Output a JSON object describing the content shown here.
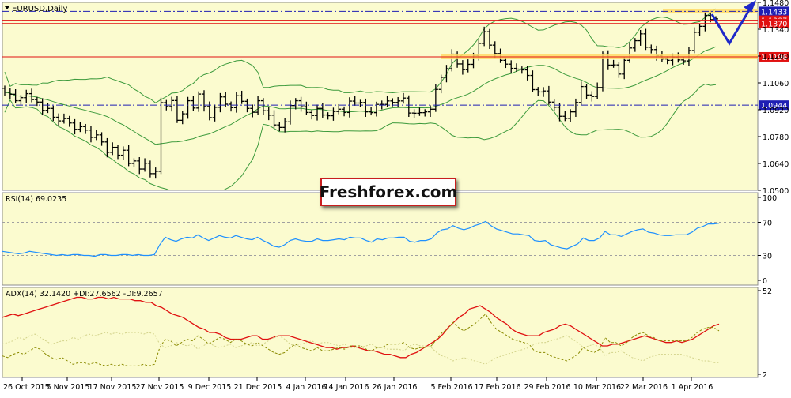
{
  "colors": {
    "background": "#fbfbcf",
    "frame": "#8c8c8c",
    "bars": "#000000",
    "bollinger": "#3c9a3c",
    "level_line": "#e11111",
    "level_band": "#ffd966",
    "dash_line": "#1e1eb4",
    "rsi_line": "#1e90ff",
    "adx_line": "#e01010",
    "plus_di": "#8a8a00",
    "minus_di": "#d2d28a",
    "forecast": "#1e28c8",
    "red_tag": "#e11111",
    "blue_tag": "#1e1eb4"
  },
  "chart_data": [
    {
      "type": "ohlc",
      "title": "EURUSD,Daily",
      "ylim": [
        1.05,
        1.148
      ],
      "y_ticks": [
        "1.1480",
        "1.1340",
        "1.1200",
        "1.1060",
        "1.0920",
        "1.0780",
        "1.0640",
        "1.0500"
      ],
      "y_tick_values": [
        1.148,
        1.134,
        1.12,
        1.106,
        1.092,
        1.078,
        1.064,
        1.05
      ],
      "x_ticks": [
        "26 Oct 2015",
        "5 Nov 2015",
        "17 Nov 2015",
        "27 Nov 2015",
        "9 Dec 2015",
        "21 Dec 2015",
        "4 Jan 2016",
        "14 Jan 2016",
        "26 Jan 2016",
        "5 Feb 2016",
        "17 Feb 2016",
        "29 Feb 2016",
        "10 Mar 2016",
        "22 Mar 2016",
        "1 Apr 2016"
      ],
      "close": [
        1.1012,
        1.1001,
        1.0967,
        1.0983,
        1.1004,
        1.0973,
        1.096,
        1.0917,
        1.0927,
        1.0881,
        1.0862,
        1.0874,
        1.0851,
        1.0818,
        1.0832,
        1.0814,
        1.0776,
        1.0789,
        1.0752,
        1.0698,
        1.0724,
        1.0683,
        1.0709,
        1.064,
        1.0653,
        1.0611,
        1.0641,
        1.0587,
        1.0599,
        1.0957,
        1.0937,
        1.0968,
        1.0865,
        1.0899,
        1.0967,
        1.0929,
        1.1002,
        1.0937,
        1.0879,
        1.0933,
        1.0987,
        1.0949,
        1.0931,
        1.0993,
        1.0964,
        1.0927,
        1.0907,
        1.0967,
        1.0915,
        1.0892,
        1.0841,
        1.0828,
        1.0857,
        1.0942,
        1.0967,
        1.0936,
        1.0906,
        1.089,
        1.0927,
        1.0893,
        1.0889,
        1.0911,
        1.0923,
        1.0906,
        1.0965,
        1.0955,
        1.0958,
        1.0909,
        1.0905,
        1.0948,
        1.0948,
        1.0966,
        1.0958,
        1.0966,
        1.0981,
        1.0903,
        1.0902,
        1.0905,
        1.0909,
        1.0923,
        1.1026,
        1.1089,
        1.1134,
        1.121,
        1.1159,
        1.1129,
        1.1157,
        1.1203,
        1.1266,
        1.1327,
        1.1257,
        1.1213,
        1.1178,
        1.1158,
        1.1136,
        1.1132,
        1.1128,
        1.1099,
        1.1025,
        1.1013,
        1.1018,
        1.096,
        1.0933,
        1.0886,
        1.0875,
        1.0909,
        1.0958,
        1.1041,
        1.0997,
        1.0989,
        1.1036,
        1.121,
        1.1153,
        1.1154,
        1.1106,
        1.1178,
        1.1242,
        1.128,
        1.1316,
        1.1246,
        1.1234,
        1.1202,
        1.1185,
        1.1178,
        1.1193,
        1.118,
        1.1175,
        1.1229,
        1.1324,
        1.1355,
        1.1412,
        1.139,
        1.1394
      ],
      "levels": [
        {
          "label": "1.1433",
          "value": 1.1433,
          "style": "dash-dot",
          "tag": "blue"
        },
        {
          "label": "1.1387",
          "value": 1.1387,
          "style": "solid",
          "tag": "red"
        },
        {
          "label": "1.1370",
          "value": 1.137,
          "style": "solid",
          "tag": "red"
        },
        {
          "label": "1.1196",
          "value": 1.1196,
          "style": "solid",
          "tag": "red"
        },
        {
          "label": "1.0944",
          "value": 1.0944,
          "style": "dash-dot",
          "tag": "blue"
        }
      ]
    },
    {
      "type": "line",
      "title": "RSI(14) 69.0235",
      "ylim": [
        0,
        100
      ],
      "y_ticks": [
        "100",
        "70",
        "30",
        "0"
      ],
      "y_tick_values": [
        100,
        70,
        30,
        0
      ],
      "reference_lines": [
        70,
        30
      ],
      "values": [
        35,
        34,
        33,
        32,
        33,
        35,
        34,
        33,
        32,
        31,
        30,
        31,
        30,
        31,
        31,
        30,
        30,
        29,
        31,
        31,
        30,
        30,
        31,
        31,
        30,
        31,
        30,
        30,
        31,
        43,
        52,
        49,
        47,
        50,
        52,
        51,
        55,
        51,
        48,
        51,
        54,
        52,
        51,
        54,
        52,
        50,
        49,
        52,
        48,
        45,
        41,
        40,
        43,
        48,
        50,
        48,
        47,
        47,
        50,
        48,
        48,
        49,
        50,
        49,
        52,
        51,
        51,
        48,
        46,
        50,
        49,
        51,
        51,
        52,
        52,
        47,
        46,
        48,
        48,
        50,
        57,
        61,
        62,
        66,
        63,
        61,
        63,
        66,
        68,
        71,
        66,
        62,
        60,
        58,
        56,
        56,
        55,
        54,
        48,
        47,
        48,
        43,
        41,
        39,
        38,
        41,
        44,
        51,
        48,
        48,
        51,
        59,
        55,
        55,
        53,
        56,
        59,
        61,
        62,
        58,
        57,
        55,
        54,
        54,
        55,
        55,
        55,
        58,
        63,
        65,
        68,
        68,
        69
      ]
    },
    {
      "type": "line",
      "title": "ADX(14) 32.1420 +DI:27.6562 -DI:9.2657",
      "ylim": [
        2,
        52
      ],
      "y_ticks": [
        "52",
        "2"
      ],
      "y_tick_values": [
        52,
        2
      ],
      "series": [
        {
          "name": "ADX(14)",
          "values": [
            36,
            37,
            38,
            37,
            38,
            39,
            40,
            41,
            42,
            43,
            44,
            45,
            46,
            47,
            48,
            48,
            47,
            47,
            48,
            48,
            47,
            48,
            47,
            47,
            47,
            46,
            46,
            45,
            45,
            43,
            42,
            40,
            38,
            37,
            36,
            34,
            32,
            30,
            29,
            27,
            27,
            26,
            24,
            23,
            23,
            23,
            24,
            25,
            25,
            23,
            23,
            24,
            25,
            25,
            25,
            24,
            23,
            22,
            21,
            20,
            19,
            18,
            18,
            17,
            18,
            18,
            19,
            18,
            17,
            16,
            16,
            15,
            14,
            14,
            13,
            12,
            12,
            14,
            15,
            17,
            19,
            21,
            23,
            26,
            30,
            33,
            36,
            38,
            41,
            42,
            43,
            41,
            39,
            36,
            34,
            32,
            29,
            27,
            26,
            25,
            25,
            25,
            27,
            28,
            29,
            31,
            32,
            31,
            29,
            27,
            25,
            23,
            21,
            19,
            19,
            20,
            20,
            21,
            22,
            23,
            24,
            25,
            24,
            23,
            22,
            21,
            21,
            22,
            21,
            22,
            23,
            25,
            27,
            29,
            31,
            32
          ]
        },
        {
          "name": "+DI",
          "values": [
            13,
            12,
            14,
            15,
            14,
            16,
            18,
            17,
            14,
            12,
            11,
            12,
            10,
            8,
            9,
            9,
            8,
            9,
            8,
            7,
            8,
            7,
            8,
            7,
            7,
            7,
            8,
            7,
            8,
            18,
            23,
            22,
            19,
            21,
            23,
            22,
            25,
            23,
            20,
            22,
            24,
            23,
            21,
            23,
            22,
            20,
            19,
            21,
            19,
            17,
            15,
            14,
            15,
            18,
            20,
            18,
            17,
            16,
            18,
            16,
            16,
            17,
            18,
            17,
            19,
            19,
            19,
            17,
            16,
            18,
            18,
            20,
            20,
            20,
            21,
            18,
            17,
            18,
            18,
            19,
            23,
            27,
            29,
            33,
            30,
            28,
            30,
            32,
            35,
            38,
            33,
            29,
            27,
            25,
            23,
            22,
            21,
            20,
            16,
            15,
            15,
            13,
            12,
            11,
            10,
            12,
            14,
            18,
            16,
            15,
            17,
            24,
            21,
            21,
            19,
            21,
            24,
            26,
            27,
            25,
            24,
            22,
            22,
            22,
            22,
            22,
            22,
            24,
            27,
            29,
            30,
            30,
            28
          ]
        },
        {
          "name": "-DI",
          "values": [
            20,
            21,
            22,
            24,
            23,
            25,
            26,
            24,
            22,
            20,
            21,
            22,
            22,
            24,
            23,
            25,
            26,
            25,
            26,
            27,
            26,
            27,
            26,
            27,
            27,
            27,
            26,
            27,
            26,
            20,
            18,
            19,
            21,
            20,
            19,
            20,
            17,
            19,
            21,
            19,
            18,
            19,
            20,
            18,
            19,
            20,
            21,
            19,
            20,
            22,
            24,
            25,
            23,
            20,
            19,
            20,
            21,
            22,
            20,
            21,
            21,
            20,
            19,
            20,
            18,
            18,
            18,
            19,
            20,
            18,
            18,
            17,
            17,
            17,
            16,
            19,
            20,
            19,
            19,
            18,
            15,
            13,
            12,
            10,
            11,
            12,
            11,
            10,
            9,
            8,
            10,
            12,
            13,
            14,
            15,
            16,
            17,
            18,
            20,
            21,
            21,
            22,
            23,
            24,
            25,
            23,
            21,
            18,
            19,
            20,
            18,
            13,
            15,
            15,
            16,
            14,
            12,
            11,
            10,
            12,
            13,
            14,
            14,
            14,
            14,
            14,
            13,
            12,
            11,
            10,
            10,
            9,
            9
          ]
        }
      ]
    }
  ],
  "watermark": "Freshforex.com"
}
